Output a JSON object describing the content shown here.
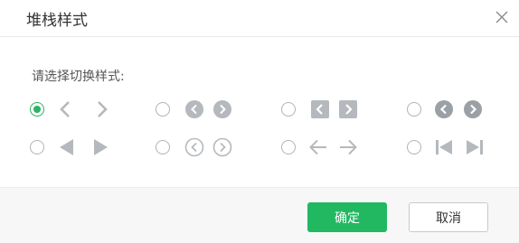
{
  "dialog": {
    "title": "堆栈样式",
    "prompt": "请选择切换样式:",
    "selected_option": "simple-chevron",
    "options": [
      {
        "id": "simple-chevron",
        "icons": [
          "chevron-left-icon",
          "chevron-right-icon"
        ],
        "checked": true
      },
      {
        "id": "filled-circle-chevron",
        "icons": [
          "circle-chevron-left-icon",
          "circle-chevron-right-icon"
        ],
        "checked": false
      },
      {
        "id": "filled-square-chevron",
        "icons": [
          "square-chevron-left-icon",
          "square-chevron-right-icon"
        ],
        "checked": false
      },
      {
        "id": "dark-circle-chevron",
        "icons": [
          "dark-circle-chevron-left-icon",
          "dark-circle-chevron-right-icon"
        ],
        "checked": false
      },
      {
        "id": "triangle",
        "icons": [
          "triangle-left-icon",
          "triangle-right-icon"
        ],
        "checked": false
      },
      {
        "id": "outline-circle-chevron",
        "icons": [
          "outline-circle-chevron-left-icon",
          "outline-circle-chevron-right-icon"
        ],
        "checked": false
      },
      {
        "id": "arrow",
        "icons": [
          "arrow-left-icon",
          "arrow-right-icon"
        ],
        "checked": false
      },
      {
        "id": "skip",
        "icons": [
          "skip-back-icon",
          "skip-forward-icon"
        ],
        "checked": false
      }
    ]
  },
  "buttons": {
    "ok_label": "确定",
    "cancel_label": "取消"
  },
  "colors": {
    "accent": "#22b862",
    "icon_gray": "#b5b9bd",
    "icon_dark": "#9aa0a6"
  }
}
